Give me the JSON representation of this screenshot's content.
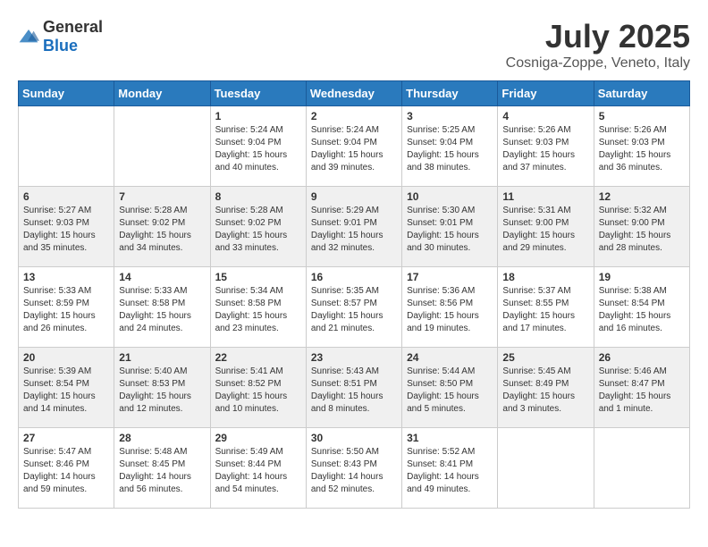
{
  "header": {
    "logo_general": "General",
    "logo_blue": "Blue",
    "month_year": "July 2025",
    "location": "Cosniga-Zoppe, Veneto, Italy"
  },
  "calendar": {
    "weekdays": [
      "Sunday",
      "Monday",
      "Tuesday",
      "Wednesday",
      "Thursday",
      "Friday",
      "Saturday"
    ],
    "weeks": [
      [
        {
          "day": "",
          "info": ""
        },
        {
          "day": "",
          "info": ""
        },
        {
          "day": "1",
          "info": "Sunrise: 5:24 AM\nSunset: 9:04 PM\nDaylight: 15 hours and 40 minutes."
        },
        {
          "day": "2",
          "info": "Sunrise: 5:24 AM\nSunset: 9:04 PM\nDaylight: 15 hours and 39 minutes."
        },
        {
          "day": "3",
          "info": "Sunrise: 5:25 AM\nSunset: 9:04 PM\nDaylight: 15 hours and 38 minutes."
        },
        {
          "day": "4",
          "info": "Sunrise: 5:26 AM\nSunset: 9:03 PM\nDaylight: 15 hours and 37 minutes."
        },
        {
          "day": "5",
          "info": "Sunrise: 5:26 AM\nSunset: 9:03 PM\nDaylight: 15 hours and 36 minutes."
        }
      ],
      [
        {
          "day": "6",
          "info": "Sunrise: 5:27 AM\nSunset: 9:03 PM\nDaylight: 15 hours and 35 minutes."
        },
        {
          "day": "7",
          "info": "Sunrise: 5:28 AM\nSunset: 9:02 PM\nDaylight: 15 hours and 34 minutes."
        },
        {
          "day": "8",
          "info": "Sunrise: 5:28 AM\nSunset: 9:02 PM\nDaylight: 15 hours and 33 minutes."
        },
        {
          "day": "9",
          "info": "Sunrise: 5:29 AM\nSunset: 9:01 PM\nDaylight: 15 hours and 32 minutes."
        },
        {
          "day": "10",
          "info": "Sunrise: 5:30 AM\nSunset: 9:01 PM\nDaylight: 15 hours and 30 minutes."
        },
        {
          "day": "11",
          "info": "Sunrise: 5:31 AM\nSunset: 9:00 PM\nDaylight: 15 hours and 29 minutes."
        },
        {
          "day": "12",
          "info": "Sunrise: 5:32 AM\nSunset: 9:00 PM\nDaylight: 15 hours and 28 minutes."
        }
      ],
      [
        {
          "day": "13",
          "info": "Sunrise: 5:33 AM\nSunset: 8:59 PM\nDaylight: 15 hours and 26 minutes."
        },
        {
          "day": "14",
          "info": "Sunrise: 5:33 AM\nSunset: 8:58 PM\nDaylight: 15 hours and 24 minutes."
        },
        {
          "day": "15",
          "info": "Sunrise: 5:34 AM\nSunset: 8:58 PM\nDaylight: 15 hours and 23 minutes."
        },
        {
          "day": "16",
          "info": "Sunrise: 5:35 AM\nSunset: 8:57 PM\nDaylight: 15 hours and 21 minutes."
        },
        {
          "day": "17",
          "info": "Sunrise: 5:36 AM\nSunset: 8:56 PM\nDaylight: 15 hours and 19 minutes."
        },
        {
          "day": "18",
          "info": "Sunrise: 5:37 AM\nSunset: 8:55 PM\nDaylight: 15 hours and 17 minutes."
        },
        {
          "day": "19",
          "info": "Sunrise: 5:38 AM\nSunset: 8:54 PM\nDaylight: 15 hours and 16 minutes."
        }
      ],
      [
        {
          "day": "20",
          "info": "Sunrise: 5:39 AM\nSunset: 8:54 PM\nDaylight: 15 hours and 14 minutes."
        },
        {
          "day": "21",
          "info": "Sunrise: 5:40 AM\nSunset: 8:53 PM\nDaylight: 15 hours and 12 minutes."
        },
        {
          "day": "22",
          "info": "Sunrise: 5:41 AM\nSunset: 8:52 PM\nDaylight: 15 hours and 10 minutes."
        },
        {
          "day": "23",
          "info": "Sunrise: 5:43 AM\nSunset: 8:51 PM\nDaylight: 15 hours and 8 minutes."
        },
        {
          "day": "24",
          "info": "Sunrise: 5:44 AM\nSunset: 8:50 PM\nDaylight: 15 hours and 5 minutes."
        },
        {
          "day": "25",
          "info": "Sunrise: 5:45 AM\nSunset: 8:49 PM\nDaylight: 15 hours and 3 minutes."
        },
        {
          "day": "26",
          "info": "Sunrise: 5:46 AM\nSunset: 8:47 PM\nDaylight: 15 hours and 1 minute."
        }
      ],
      [
        {
          "day": "27",
          "info": "Sunrise: 5:47 AM\nSunset: 8:46 PM\nDaylight: 14 hours and 59 minutes."
        },
        {
          "day": "28",
          "info": "Sunrise: 5:48 AM\nSunset: 8:45 PM\nDaylight: 14 hours and 56 minutes."
        },
        {
          "day": "29",
          "info": "Sunrise: 5:49 AM\nSunset: 8:44 PM\nDaylight: 14 hours and 54 minutes."
        },
        {
          "day": "30",
          "info": "Sunrise: 5:50 AM\nSunset: 8:43 PM\nDaylight: 14 hours and 52 minutes."
        },
        {
          "day": "31",
          "info": "Sunrise: 5:52 AM\nSunset: 8:41 PM\nDaylight: 14 hours and 49 minutes."
        },
        {
          "day": "",
          "info": ""
        },
        {
          "day": "",
          "info": ""
        }
      ]
    ]
  }
}
